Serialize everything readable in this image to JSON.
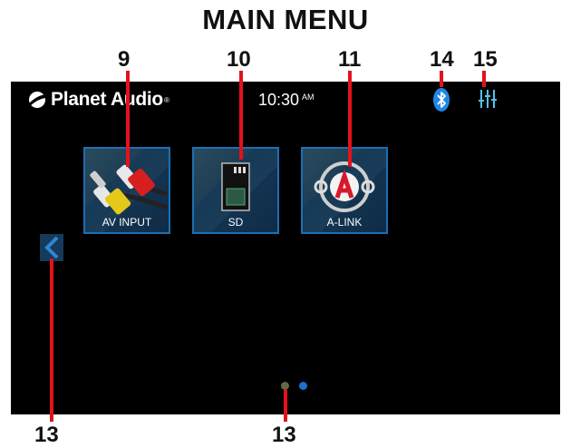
{
  "page_title": "MAIN MENU",
  "callouts": {
    "av_input": "9",
    "sd": "10",
    "a_link": "11",
    "bluetooth": "14",
    "equalizer": "15",
    "back_left": "13",
    "page_dots": "13"
  },
  "status_bar": {
    "logo": "Planet Audio",
    "time": "10:30",
    "ampm": "AM",
    "bluetooth_icon": "bluetooth-icon",
    "eq_icon": "equalizer-icon"
  },
  "tiles": [
    {
      "label": "AV INPUT",
      "icon": "rca-cable-icon"
    },
    {
      "label": "SD",
      "icon": "sd-card-icon"
    },
    {
      "label": "A-LINK",
      "icon": "a-link-icon"
    }
  ],
  "pagination": {
    "pages": 2,
    "current": 2
  },
  "colors": {
    "accent": "#1d6fb3",
    "callout": "#e3121b",
    "eq": "#4fc3e8",
    "screen": "#000000"
  }
}
